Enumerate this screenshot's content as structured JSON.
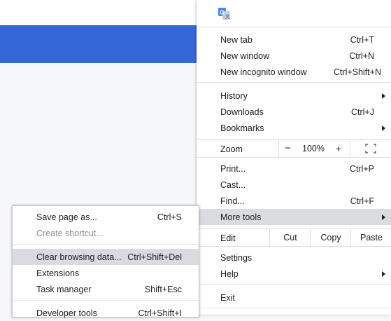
{
  "menu": {
    "new_tab": {
      "label": "New tab",
      "shortcut": "Ctrl+T"
    },
    "new_window": {
      "label": "New window",
      "shortcut": "Ctrl+N"
    },
    "new_incognito": {
      "label": "New incognito window",
      "shortcut": "Ctrl+Shift+N"
    },
    "history": {
      "label": "History"
    },
    "downloads": {
      "label": "Downloads",
      "shortcut": "Ctrl+J"
    },
    "bookmarks": {
      "label": "Bookmarks"
    },
    "zoom": {
      "label": "Zoom",
      "minus": "−",
      "value": "100%",
      "plus": "+"
    },
    "print": {
      "label": "Print...",
      "shortcut": "Ctrl+P"
    },
    "cast": {
      "label": "Cast..."
    },
    "find": {
      "label": "Find...",
      "shortcut": "Ctrl+F"
    },
    "more_tools": {
      "label": "More tools"
    },
    "edit": {
      "label": "Edit",
      "cut": "Cut",
      "copy": "Copy",
      "paste": "Paste"
    },
    "settings": {
      "label": "Settings"
    },
    "help": {
      "label": "Help"
    },
    "exit": {
      "label": "Exit"
    }
  },
  "submenu": {
    "save_page": {
      "label": "Save page as...",
      "shortcut": "Ctrl+S"
    },
    "create_shortcut": {
      "label": "Create shortcut..."
    },
    "clear_browsing": {
      "label": "Clear browsing data...",
      "shortcut": "Ctrl+Shift+Del"
    },
    "extensions": {
      "label": "Extensions"
    },
    "task_manager": {
      "label": "Task manager",
      "shortcut": "Shift+Esc"
    },
    "developer_tools": {
      "label": "Developer tools",
      "shortcut": "Ctrl+Shift+I"
    }
  },
  "colors": {
    "page_bar": "#3567d6",
    "highlight": "#dadbdf",
    "translate_icon": "#4a86e8"
  }
}
